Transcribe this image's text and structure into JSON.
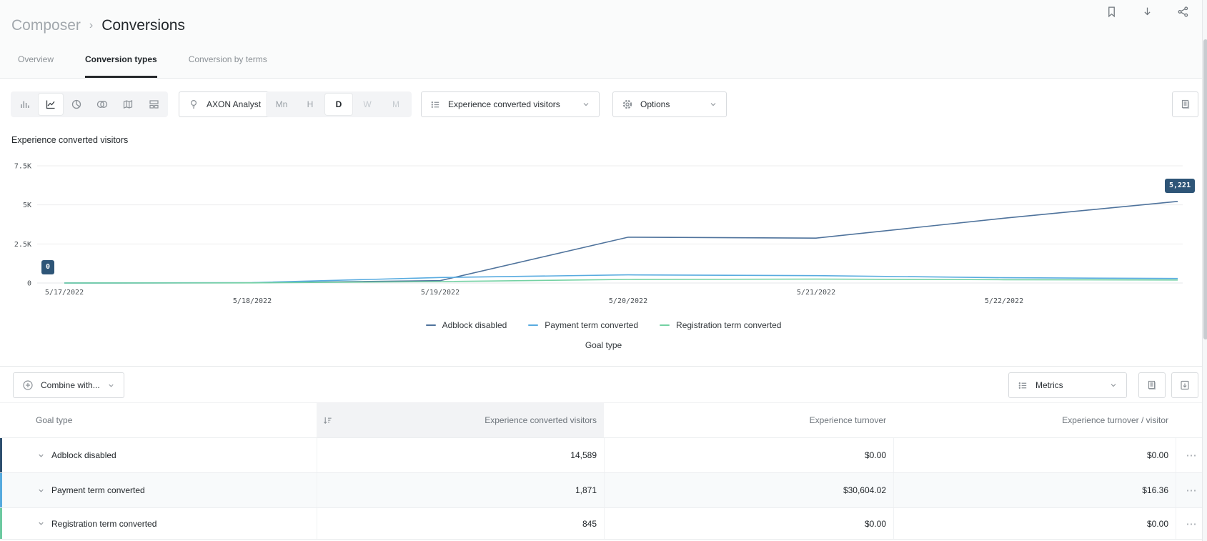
{
  "header": {
    "breadcrumb": {
      "parent": "Composer",
      "separator": "›",
      "current": "Conversions"
    },
    "action_icons": [
      "bookmark-icon",
      "download-icon",
      "share-icon"
    ],
    "tabs": [
      {
        "label": "Overview",
        "active": false
      },
      {
        "label": "Conversion types",
        "active": true
      },
      {
        "label": "Conversion by terms",
        "active": false
      }
    ]
  },
  "toolbar": {
    "chart_types": [
      {
        "name": "bar-chart",
        "active": false
      },
      {
        "name": "line-chart",
        "active": true
      },
      {
        "name": "pie-chart",
        "active": false
      },
      {
        "name": "venn-diagram",
        "active": false
      },
      {
        "name": "map",
        "active": false
      },
      {
        "name": "dashboard-layout",
        "active": false
      }
    ],
    "axon_label": "AXON Analyst",
    "granularity": {
      "options": [
        "Mn",
        "H",
        "D",
        "W",
        "M"
      ],
      "selected": "D",
      "disabled": [
        "W",
        "M"
      ]
    },
    "dimension_label": "Experience converted visitors",
    "options_label": "Options"
  },
  "chart_data": {
    "type": "line",
    "title": "Experience converted visitors",
    "x": [
      "5/17/2022",
      "5/18/2022",
      "5/19/2022",
      "5/20/2022",
      "5/21/2022",
      "5/22/2022",
      ""
    ],
    "series": [
      {
        "name": "Adblock disabled",
        "color": "#4f739c",
        "values": [
          0,
          15,
          150,
          2930,
          2870,
          4150,
          5221
        ]
      },
      {
        "name": "Payment term converted",
        "color": "#58abe0",
        "values": [
          0,
          25,
          350,
          520,
          470,
          340,
          290
        ]
      },
      {
        "name": "Registration term converted",
        "color": "#74d1a3",
        "values": [
          0,
          10,
          90,
          230,
          250,
          210,
          190
        ]
      }
    ],
    "ylim": [
      0,
      7500
    ],
    "yticks": [
      {
        "value": 0,
        "label": "0"
      },
      {
        "value": 2500,
        "label": "2.5K"
      },
      {
        "value": 5000,
        "label": "5K"
      },
      {
        "value": 7500,
        "label": "7.5K"
      }
    ],
    "annotations": [
      {
        "text": "0",
        "series": 0,
        "x_index": 0,
        "anchor": "start"
      },
      {
        "text": "5,221",
        "series": 0,
        "x_index": 6,
        "anchor": "end"
      }
    ],
    "legend_position": "bottom",
    "legend_title": "Goal type",
    "grid": true
  },
  "controls": {
    "combine_label": "Combine with...",
    "metrics_label": "Metrics",
    "icon_buttons": [
      "report-icon",
      "export-icon"
    ]
  },
  "table": {
    "columns": [
      "Goal type",
      "Experience converted visitors",
      "Experience turnover",
      "Experience turnover / visitor"
    ],
    "sorted_column": "Experience converted visitors",
    "sort_direction": "descending",
    "rows": [
      {
        "label": "Adblock disabled",
        "color": "#2d4f6e",
        "values": [
          "14,589",
          "$0.00",
          "$0.00"
        ]
      },
      {
        "label": "Payment term converted",
        "color": "#56aade",
        "values": [
          "1,871",
          "$30,604.02",
          "$16.36"
        ]
      },
      {
        "label": "Registration term converted",
        "color": "#6cc9a0",
        "values": [
          "845",
          "$0.00",
          "$0.00"
        ]
      }
    ],
    "row_menu": "⋯"
  },
  "colors": {
    "accent_dark_badge": "#2e5577",
    "grid_line": "#ededee",
    "header_bg": "#fafbfb",
    "sorted_header_bg": "#f2f3f5"
  }
}
